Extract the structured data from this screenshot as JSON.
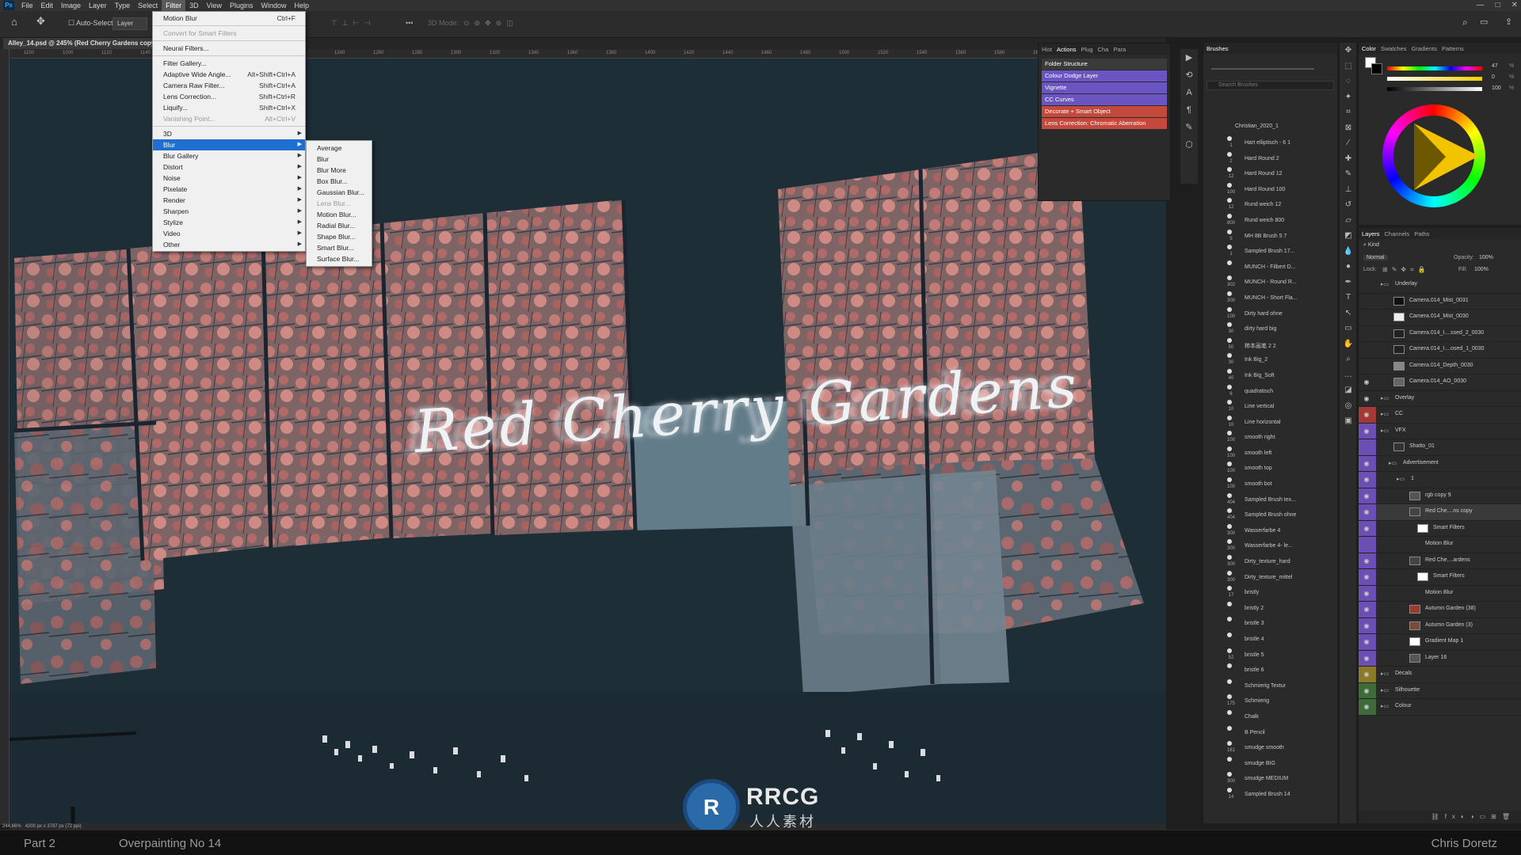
{
  "menubar": {
    "logo": "Ps",
    "items": [
      "File",
      "Edit",
      "Image",
      "Layer",
      "Type",
      "Select",
      "Filter",
      "3D",
      "View",
      "Plugins",
      "Window",
      "Help"
    ],
    "active_index": 6,
    "window_controls": [
      "—",
      "□",
      "✕"
    ]
  },
  "options_bar": {
    "auto_select_label": "Auto-Select:",
    "auto_select_value": "Layer",
    "mode_3d": "3D Mode:"
  },
  "document": {
    "tab_title": "Alley_14.psd @ 245% (Red Cherry Gardens copy...",
    "ruler_ticks": [
      "1100",
      "1000",
      "1120",
      "1140",
      "1160",
      "1180",
      "1200",
      "1220",
      "1240",
      "1260",
      "1280",
      "1300",
      "1320",
      "1340",
      "1360",
      "1380",
      "1400",
      "1420",
      "1440",
      "1460",
      "1480",
      "1500",
      "1520",
      "1540",
      "1560",
      "1580",
      "1600",
      "1620",
      "1640"
    ],
    "zoom": "244.66%",
    "dimensions": "4200 px x 3787 px (72 ppi)",
    "artwork_text": "Red Cherry Gardens"
  },
  "filter_menu": {
    "items": [
      {
        "label": "Motion Blur",
        "shortcut": "Ctrl+F",
        "disabled": false,
        "submenu": false
      },
      {
        "sep": true
      },
      {
        "label": "Convert for Smart Filters",
        "shortcut": "",
        "disabled": true,
        "submenu": false
      },
      {
        "sep": true
      },
      {
        "label": "Neural Filters...",
        "shortcut": "",
        "disabled": false,
        "submenu": false
      },
      {
        "sep": true
      },
      {
        "label": "Filter Gallery...",
        "shortcut": "",
        "disabled": false,
        "submenu": false
      },
      {
        "label": "Adaptive Wide Angle...",
        "shortcut": "Alt+Shift+Ctrl+A",
        "disabled": false,
        "submenu": false
      },
      {
        "label": "Camera Raw Filter...",
        "shortcut": "Shift+Ctrl+A",
        "disabled": false,
        "submenu": false
      },
      {
        "label": "Lens Correction...",
        "shortcut": "Shift+Ctrl+R",
        "disabled": false,
        "submenu": false
      },
      {
        "label": "Liquify...",
        "shortcut": "Shift+Ctrl+X",
        "disabled": false,
        "submenu": false
      },
      {
        "label": "Vanishing Point...",
        "shortcut": "Alt+Ctrl+V",
        "disabled": true,
        "submenu": false
      },
      {
        "sep": true
      },
      {
        "label": "3D",
        "shortcut": "",
        "disabled": false,
        "submenu": true
      },
      {
        "label": "Blur",
        "shortcut": "",
        "disabled": false,
        "submenu": true,
        "highlighted": true
      },
      {
        "label": "Blur Gallery",
        "shortcut": "",
        "disabled": false,
        "submenu": true
      },
      {
        "label": "Distort",
        "shortcut": "",
        "disabled": false,
        "submenu": true
      },
      {
        "label": "Noise",
        "shortcut": "",
        "disabled": false,
        "submenu": true
      },
      {
        "label": "Pixelate",
        "shortcut": "",
        "disabled": false,
        "submenu": true
      },
      {
        "label": "Render",
        "shortcut": "",
        "disabled": false,
        "submenu": true
      },
      {
        "label": "Sharpen",
        "shortcut": "",
        "disabled": false,
        "submenu": true
      },
      {
        "label": "Stylize",
        "shortcut": "",
        "disabled": false,
        "submenu": true
      },
      {
        "label": "Video",
        "shortcut": "",
        "disabled": false,
        "submenu": true
      },
      {
        "label": "Other",
        "shortcut": "",
        "disabled": false,
        "submenu": true
      }
    ]
  },
  "blur_submenu": {
    "items": [
      {
        "label": "Average",
        "disabled": false
      },
      {
        "label": "Blur",
        "disabled": false
      },
      {
        "label": "Blur More",
        "disabled": false
      },
      {
        "label": "Box Blur...",
        "disabled": false
      },
      {
        "label": "Gaussian Blur...",
        "disabled": false
      },
      {
        "label": "Lens Blur...",
        "disabled": true
      },
      {
        "label": "Motion Blur...",
        "disabled": false
      },
      {
        "label": "Radial Blur...",
        "disabled": false
      },
      {
        "label": "Shape Blur...",
        "disabled": false
      },
      {
        "label": "Smart Blur...",
        "disabled": false
      },
      {
        "label": "Surface Blur...",
        "disabled": false
      }
    ]
  },
  "actions_panel": {
    "tabs": [
      "Hist",
      "Actions",
      "Plug",
      "Cha",
      "Para"
    ],
    "active_tab": "Actions",
    "actions": [
      {
        "label": "Folder Structure",
        "color": "#3a3a3a"
      },
      {
        "label": "Colour Dodge Layer",
        "color": "#6b55c2"
      },
      {
        "label": "Vignette",
        "color": "#6b55c2"
      },
      {
        "label": "CC Curves",
        "color": "#6b55c2"
      },
      {
        "label": "Decorate + Smart Object",
        "color": "#c5483c"
      },
      {
        "label": "Lens Correction: Chromatic Aberration",
        "color": "#c5483c"
      }
    ]
  },
  "brushes_panel": {
    "title": "Brushes",
    "search_placeholder": "Search Brushes",
    "group": "Christian_2020_1",
    "brushes": [
      {
        "size": "1",
        "name": "Hart elliptisch - 6 1"
      },
      {
        "size": "2",
        "name": "Hard Round 2"
      },
      {
        "size": "12",
        "name": "Hard Round 12"
      },
      {
        "size": "100",
        "name": "Hard Round 100"
      },
      {
        "size": "12",
        "name": "Rund weich 12"
      },
      {
        "size": "800",
        "name": "Rund weich 800"
      },
      {
        "size": "5",
        "name": "MH 8B Brush 5 7"
      },
      {
        "size": "1",
        "name": "Sampled Brush 17..."
      },
      {
        "size": "",
        "name": "MUNCH - Filbert D..."
      },
      {
        "size": "302",
        "name": "MUNCH - Round R..."
      },
      {
        "size": "300",
        "name": "MUNCH - Short Fla..."
      },
      {
        "size": "100",
        "name": "Dirty hard ohne"
      },
      {
        "size": "30",
        "name": "dirty hard big"
      },
      {
        "size": "50",
        "name": "柿本画笔 2 2"
      },
      {
        "size": "30",
        "name": "Ink Big_2"
      },
      {
        "size": "40",
        "name": "Ink Big_Soft"
      },
      {
        "size": "6",
        "name": "quadratisch"
      },
      {
        "size": "10",
        "name": "Line vertical"
      },
      {
        "size": "10",
        "name": "Line horizontal"
      },
      {
        "size": "100",
        "name": "smooth right"
      },
      {
        "size": "100",
        "name": "smooth left"
      },
      {
        "size": "100",
        "name": "smooth top"
      },
      {
        "size": "100",
        "name": "smooth bot"
      },
      {
        "size": "404",
        "name": "Sampled Brush tex..."
      },
      {
        "size": "404",
        "name": "Sampled Brush ohne"
      },
      {
        "size": "300",
        "name": "Wasserfarbe 4"
      },
      {
        "size": "300",
        "name": "Wasserfarbe 4- le..."
      },
      {
        "size": "300",
        "name": "Dirty_texture_hard"
      },
      {
        "size": "300",
        "name": "Dirty_texture_mittel"
      },
      {
        "size": "17",
        "name": "bristly"
      },
      {
        "size": "",
        "name": "bristly 2"
      },
      {
        "size": "",
        "name": "bristle 3"
      },
      {
        "size": "",
        "name": "bristle 4"
      },
      {
        "size": "52",
        "name": "bristle 5"
      },
      {
        "size": "",
        "name": "bristle 6"
      },
      {
        "size": "",
        "name": "Schmierig Textur"
      },
      {
        "size": "175",
        "name": "Schmierig"
      },
      {
        "size": "",
        "name": "Chalk"
      },
      {
        "size": "",
        "name": "B Pencil"
      },
      {
        "size": "161",
        "name": "smudge smooth"
      },
      {
        "size": "",
        "name": "smudge BIG"
      },
      {
        "size": "300",
        "name": "smudge MEDIUM"
      },
      {
        "size": "14",
        "name": "Sampled Brush 14"
      }
    ]
  },
  "color_panel": {
    "tabs": [
      "Color",
      "Swatches",
      "Gradients",
      "Patterns"
    ],
    "active_tab": "Color",
    "h_value": "47",
    "s_value": "0",
    "b_value": "100",
    "unit": "%"
  },
  "layers_panel": {
    "tabs": [
      "Layers",
      "Channels",
      "Paths"
    ],
    "active_tab": "Layers",
    "kind_label": "Kind",
    "blend_mode": "Normal",
    "opacity_label": "Opacity:",
    "opacity_value": "100%",
    "lock_label": "Lock:",
    "fill_label": "Fill:",
    "fill_value": "100%",
    "layers": [
      {
        "name": "Underlay",
        "type": "group",
        "indent": 0,
        "tag": "none",
        "eye": false
      },
      {
        "name": "Camera.014_Mist_0031",
        "type": "layer",
        "indent": 1,
        "tag": "none",
        "eye": false,
        "thumb": "#111"
      },
      {
        "name": "Camera.014_Mist_0030",
        "type": "layer",
        "indent": 1,
        "tag": "none",
        "eye": false,
        "thumb": "#eee"
      },
      {
        "name": "Camera.014_I....ssed_2_0030",
        "type": "layer",
        "indent": 1,
        "tag": "none",
        "eye": false,
        "thumb": "#222"
      },
      {
        "name": "Camera.014_I....osed_1_0030",
        "type": "layer",
        "indent": 1,
        "tag": "none",
        "eye": false,
        "thumb": "#222"
      },
      {
        "name": "Camera.014_Depth_0030",
        "type": "layer",
        "indent": 1,
        "tag": "none",
        "eye": false,
        "thumb": "#888"
      },
      {
        "name": "Camera.014_AO_0030",
        "type": "layer",
        "indent": 1,
        "tag": "none",
        "eye": true,
        "thumb": "#666"
      },
      {
        "name": "Overlay",
        "type": "group",
        "indent": 0,
        "tag": "none",
        "eye": true
      },
      {
        "name": "CC",
        "type": "group",
        "indent": 0,
        "tag": "red",
        "eye": true
      },
      {
        "name": "VFX",
        "type": "group",
        "indent": 0,
        "tag": "purple",
        "eye": true
      },
      {
        "name": "Shatto_01",
        "type": "layer",
        "indent": 1,
        "tag": "purple",
        "eye": false,
        "thumb": "#333"
      },
      {
        "name": "Advertisement",
        "type": "group",
        "indent": 1,
        "tag": "purple",
        "eye": true
      },
      {
        "name": "1",
        "type": "group",
        "indent": 2,
        "tag": "purple",
        "eye": true
      },
      {
        "name": "rgb copy 9",
        "type": "layer",
        "indent": 3,
        "tag": "purple",
        "eye": true,
        "thumb": "#555"
      },
      {
        "name": "Red Che....ns copy",
        "type": "layer",
        "indent": 3,
        "tag": "purple",
        "eye": true,
        "thumb": "#444",
        "selected": true
      },
      {
        "name": "Smart Filters",
        "type": "filter",
        "indent": 4,
        "tag": "purple",
        "eye": true,
        "thumb": "#fff"
      },
      {
        "name": "Motion Blur",
        "type": "filteritem",
        "indent": 4,
        "tag": "purple",
        "eye": false
      },
      {
        "name": "Red Che....ardens",
        "type": "layer",
        "indent": 3,
        "tag": "purple",
        "eye": true,
        "thumb": "#444"
      },
      {
        "name": "Smart Filters",
        "type": "filter",
        "indent": 4,
        "tag": "purple",
        "eye": true,
        "thumb": "#fff"
      },
      {
        "name": "Motion Blur",
        "type": "filteritem",
        "indent": 4,
        "tag": "purple",
        "eye": true
      },
      {
        "name": "Autumn Garden (38)",
        "type": "layer",
        "indent": 3,
        "tag": "purple",
        "eye": true,
        "thumb": "#9a3b2e"
      },
      {
        "name": "Autumn Garden (3)",
        "type": "layer",
        "indent": 3,
        "tag": "purple",
        "eye": true,
        "thumb": "#7a4a3a"
      },
      {
        "name": "Gradient Map 1",
        "type": "layer",
        "indent": 3,
        "tag": "purple",
        "eye": true,
        "thumb": "#fff"
      },
      {
        "name": "Layer 16",
        "type": "layer",
        "indent": 3,
        "tag": "purple",
        "eye": true,
        "thumb": "#555"
      },
      {
        "name": "Decals",
        "type": "group",
        "indent": 0,
        "tag": "yellow",
        "eye": true
      },
      {
        "name": "Silhouette",
        "type": "group",
        "indent": 0,
        "tag": "green",
        "eye": true
      },
      {
        "name": "Colour",
        "type": "group",
        "indent": 0,
        "tag": "green",
        "eye": true
      }
    ]
  },
  "tag_colors": {
    "none": "transparent",
    "red": "#a33a36",
    "purple": "#6b4fb3",
    "yellow": "#8a7a2a",
    "green": "#3f6a3a"
  },
  "footer": {
    "left1": "Part 2",
    "left2": "Overpainting No 14",
    "right": "Chris Doretz"
  },
  "watermark": {
    "brand": "RRCG",
    "sub": "人人素材"
  }
}
